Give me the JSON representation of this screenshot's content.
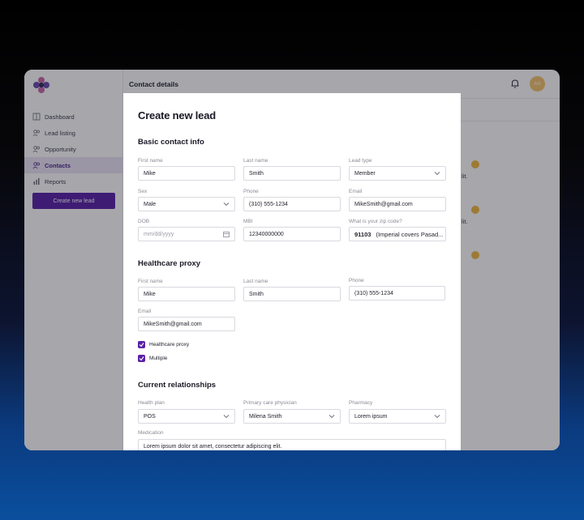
{
  "sidebar": {
    "items": [
      {
        "label": "Dashboard",
        "icon": "dashboard-icon"
      },
      {
        "label": "Lead listing",
        "icon": "people-icon"
      },
      {
        "label": "Opportunity",
        "icon": "people-icon"
      },
      {
        "label": "Contacts",
        "icon": "people-icon",
        "active": true
      },
      {
        "label": "Reports",
        "icon": "bar-chart-icon"
      }
    ],
    "create_label": "Create new lead"
  },
  "topbar": {
    "title": "Contact details",
    "avatar_initials": "AA"
  },
  "background": {
    "snippets": [
      "lit.",
      "lit."
    ]
  },
  "modal": {
    "title": "Create new lead",
    "basic": {
      "title": "Basic contact info",
      "first_name_label": "First name",
      "first_name": "Mike",
      "last_name_label": "Last name",
      "last_name": "Smith",
      "lead_type_label": "Lead type",
      "lead_type": "Member",
      "sex_label": "Sex",
      "sex": "Male",
      "phone_label": "Phone",
      "phone": "(310) 555-1234",
      "email_label": "Email",
      "email": "MikeSmith@gmail.com",
      "dob_label": "DOB",
      "dob_placeholder": "mm/dd/yyyy",
      "mbi_label": "MBI",
      "mbi": "12340000000",
      "zip_label": "What is your zip code?",
      "zip": "91103",
      "zip_note": "(Imperial covers Pasad..."
    },
    "proxy": {
      "title": "Healthcare proxy",
      "first_name_label": "First name",
      "first_name": "Mike",
      "last_name_label": "Last name",
      "last_name": "Smith",
      "phone_label": "Phone",
      "phone": "(310) 555-1234",
      "email_label": "Email",
      "email": "MikeSmith@gmail.com",
      "check_proxy": "Healthcare proxy",
      "check_multiple": "Multiple"
    },
    "relationships": {
      "title": "Current relationships",
      "health_plan_label": "Health plan",
      "health_plan": "POS",
      "pcp_label": "Primary care  physician",
      "pcp": "Milena Smith",
      "pharmacy_label": "Pharmacy",
      "pharmacy": "Lorem ipsum",
      "medication_label": "Medication",
      "medication": "Lorem ipsum dolor sit amet, consectetur adipiscing elit."
    }
  },
  "colors": {
    "accent": "#5a21a6",
    "active_bg": "#ece6f5",
    "avatar": "#f4c36b",
    "dot": "#f0b93f"
  }
}
